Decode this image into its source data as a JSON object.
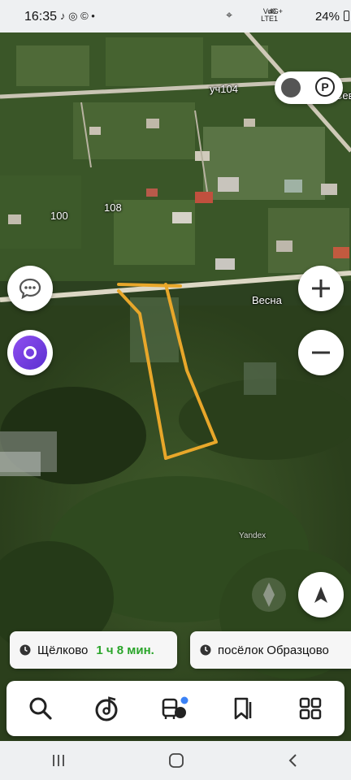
{
  "status": {
    "time": "16:35",
    "notif_icons": "♪ ◎ ©  •",
    "net_top": "Vo0",
    "net_bottom": "LTE1",
    "net_gen": "4G+",
    "battery": "24%"
  },
  "map": {
    "labels": {
      "street_top": "уч104",
      "sev": "Сев",
      "plot_100": "100",
      "plot_108": "108",
      "vesna": "Весна",
      "watermark": "Yandex"
    }
  },
  "route_suggestions": [
    {
      "destination": "Щёлково",
      "eta": "1 ч 8 мин."
    },
    {
      "destination": "посёлок Образцово",
      "eta": ""
    }
  ],
  "tabbar": {
    "items": [
      "search-icon",
      "music-icon",
      "transport-icon",
      "bookmarks-icon",
      "services-icon"
    ]
  },
  "colors": {
    "outline": "#e8a72a",
    "eta_green": "#2aa52a",
    "alice": "#6b3fe0"
  }
}
